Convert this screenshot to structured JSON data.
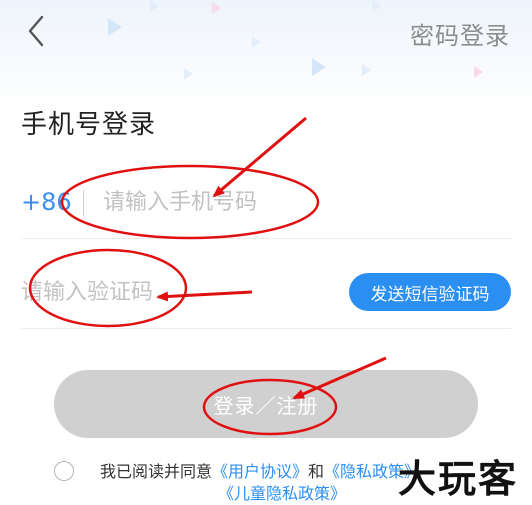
{
  "header": {
    "back_icon": "chevron-left-icon",
    "password_login_label": "密码登录"
  },
  "page_title": "手机号登录",
  "phone": {
    "country_code": "+86",
    "placeholder": "请输入手机号码",
    "value": ""
  },
  "code": {
    "placeholder": "请输入验证码",
    "value": "",
    "send_button_label": "发送短信验证码"
  },
  "login_button_label": "登录／注册",
  "agreement": {
    "prefix": "我已阅读并同意",
    "user_agreement": "《用户协议》",
    "and": "和",
    "privacy_policy": "《隐私政策》",
    "child_privacy_policy": "《儿童隐私政策》"
  },
  "watermark": "大玩客",
  "colors": {
    "accent": "#2b8ff2",
    "disabled_button": "#d0d0d0",
    "annotation_red": "#e01010"
  }
}
